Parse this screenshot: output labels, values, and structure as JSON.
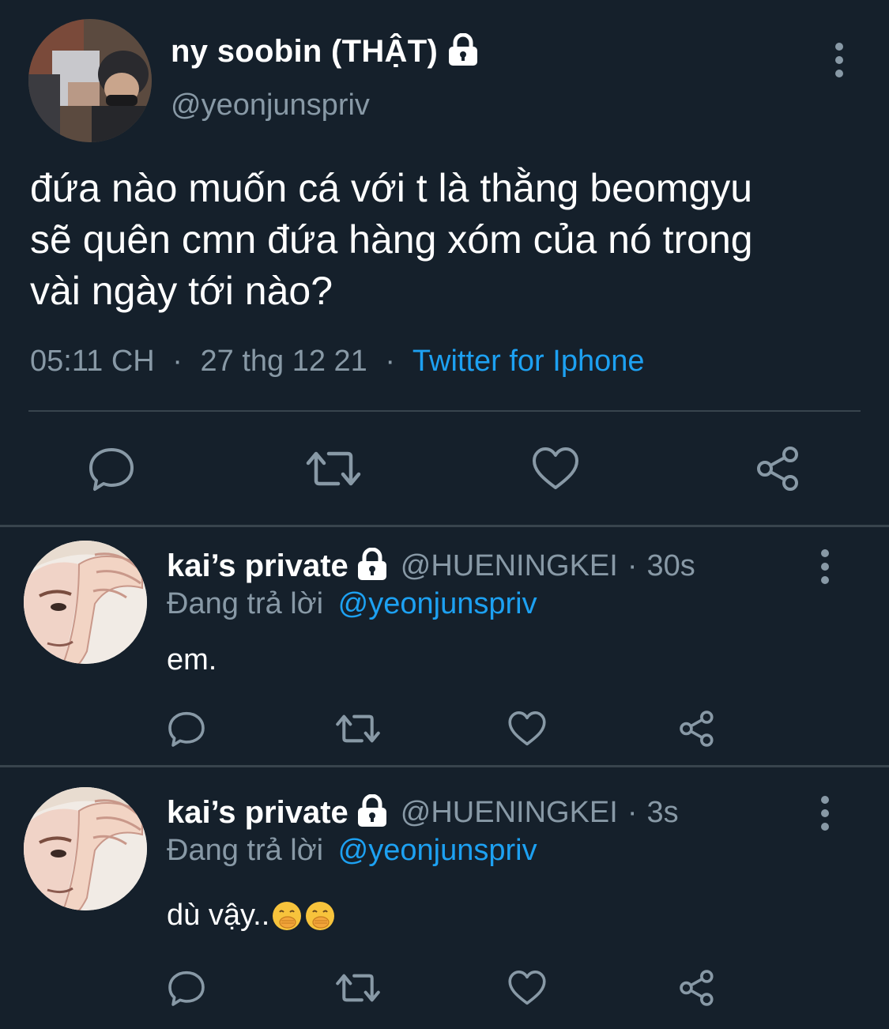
{
  "main_tweet": {
    "display_name": "ny soobin (THẬT)",
    "handle": "@yeonjunspriv",
    "text": "đứa nào muốn cá với t là thằng beomgyu\nsẽ quên cmn đứa hàng xóm của nó trong\nvài ngày tới nào?",
    "time": "05:11 CH",
    "separator": "·",
    "date": "27 thg 12 21",
    "source": "Twitter for Iphone",
    "protected_icon": "lock-icon"
  },
  "replies": [
    {
      "display_name": "kai’s private",
      "handle": "@HUENINGKEI",
      "separator": "·",
      "time_ago": "30s",
      "reply_prefix": "Đang trả lời",
      "reply_to": "@yeonjunspriv",
      "text": "em.",
      "emojis": []
    },
    {
      "display_name": "kai’s private",
      "handle": "@HUENINGKEI",
      "separator": "·",
      "time_ago": "3s",
      "reply_prefix": "Đang trả lời",
      "reply_to": "@yeonjunspriv",
      "text": "dù vậy..",
      "emojis": [
        "face-with-hand-over-mouth-emoji",
        "face-with-hand-over-mouth-emoji"
      ]
    }
  ],
  "actions": [
    "reply-icon",
    "retweet-icon",
    "like-icon",
    "share-icon"
  ],
  "colors": {
    "background": "#15202b",
    "divider": "#38444d",
    "secondary_text": "#8899a6",
    "accent": "#1da1f2",
    "primary_text": "#ffffff"
  }
}
